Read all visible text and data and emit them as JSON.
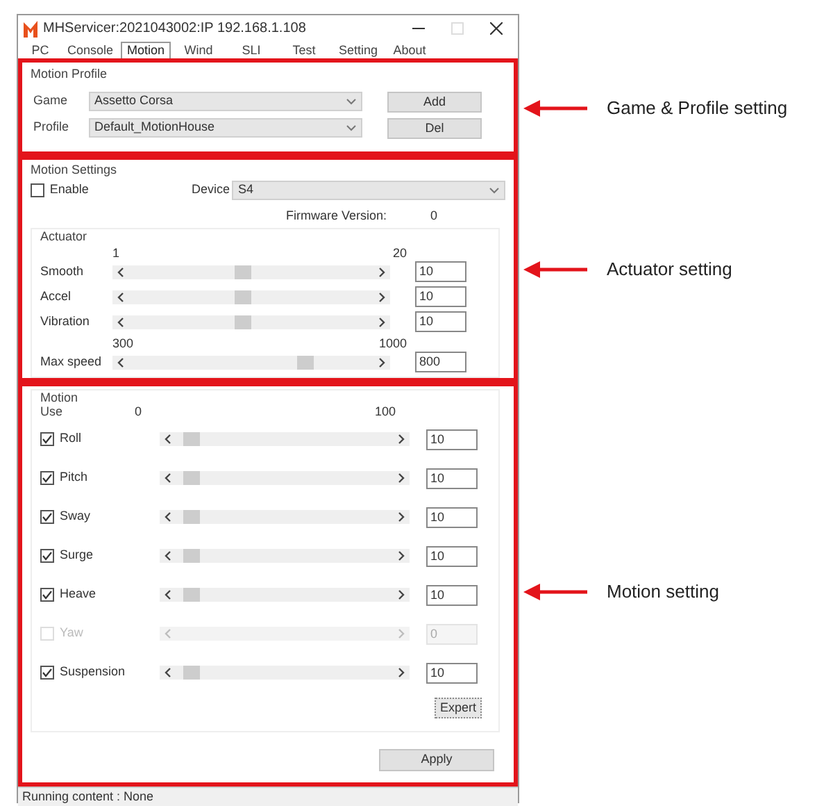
{
  "window": {
    "title": "MHServicer:2021043002:IP 192.168.1.108"
  },
  "tabs": [
    {
      "label": "PC",
      "selected": false
    },
    {
      "label": "Console",
      "selected": false
    },
    {
      "label": "Motion",
      "selected": true
    },
    {
      "label": "Wind",
      "selected": false
    },
    {
      "label": "SLI",
      "selected": false
    },
    {
      "label": "Test",
      "selected": false
    },
    {
      "label": "Setting",
      "selected": false
    },
    {
      "label": "About",
      "selected": false
    }
  ],
  "motion_profile": {
    "title": "Motion Profile",
    "fields": [
      {
        "label": "Game",
        "value": "Assetto Corsa",
        "button": "Add"
      },
      {
        "label": "Profile",
        "value": "Default_MotionHouse",
        "button": "Del"
      }
    ]
  },
  "motion_settings": {
    "title": "Motion Settings",
    "enable": {
      "label": "Enable",
      "checked": false
    },
    "device": {
      "label": "Device",
      "value": "S4"
    },
    "firmware": {
      "label": "Firmware Version:",
      "value": "0"
    },
    "actuator": {
      "title": "Actuator",
      "sliders": [
        {
          "name": "Smooth",
          "min": "1",
          "max": "20",
          "level": 0.47,
          "value": "10"
        },
        {
          "name": "Accel",
          "level": 0.47,
          "value": "10"
        },
        {
          "name": "Vibration",
          "level": 0.47,
          "value": "10"
        },
        {
          "name": "Max speed",
          "min": "300",
          "max": "1000",
          "level": 0.71,
          "value": "800"
        }
      ]
    }
  },
  "motion": {
    "title": "Motion",
    "use_label": "Use",
    "scale_min": "0",
    "scale_max": "100",
    "axes": [
      {
        "name": "Roll",
        "checked": true,
        "disabled": false,
        "level": 0.1,
        "value": "10"
      },
      {
        "name": "Pitch",
        "checked": true,
        "disabled": false,
        "level": 0.1,
        "value": "10"
      },
      {
        "name": "Sway",
        "checked": true,
        "disabled": false,
        "level": 0.1,
        "value": "10"
      },
      {
        "name": "Surge",
        "checked": true,
        "disabled": false,
        "level": 0.1,
        "value": "10"
      },
      {
        "name": "Heave",
        "checked": true,
        "disabled": false,
        "level": 0.1,
        "value": "10"
      },
      {
        "name": "Yaw",
        "checked": false,
        "disabled": true,
        "value": "0"
      },
      {
        "name": "Suspension",
        "checked": true,
        "disabled": false,
        "level": 0.1,
        "value": "10"
      }
    ],
    "expert_button": "Expert"
  },
  "apply_button": "Apply",
  "status_bar": "Running content : None",
  "annotations": [
    {
      "label": "Game & Profile setting"
    },
    {
      "label": "Actuator setting"
    },
    {
      "label": "Motion setting"
    }
  ]
}
